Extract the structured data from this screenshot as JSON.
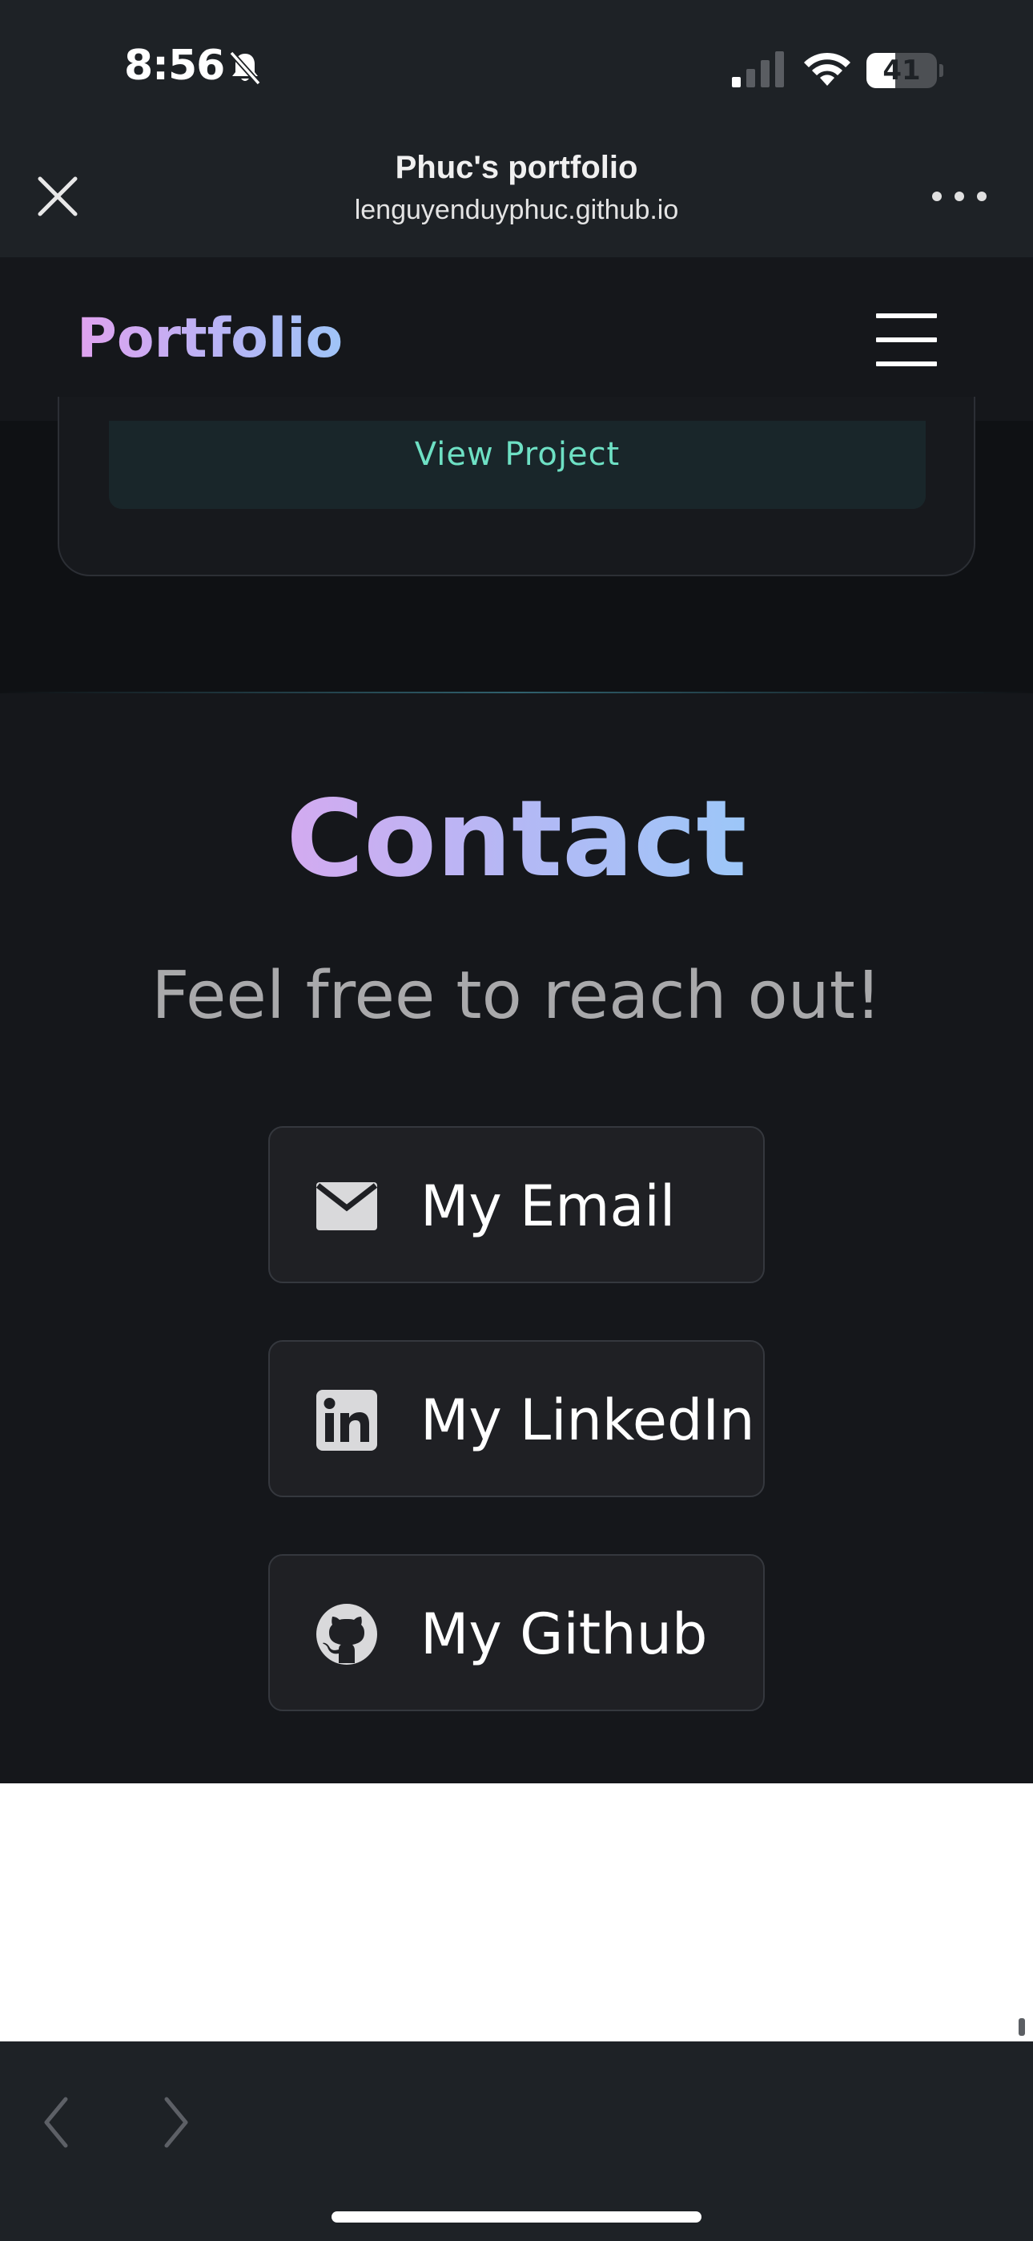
{
  "status_bar": {
    "time": "8:56",
    "battery": "41",
    "battery_level": 0.41
  },
  "browser": {
    "title": "Phuc's portfolio",
    "url": "lenguyenduyphuc.github.io"
  },
  "nav": {
    "logo": "Portfolio"
  },
  "project": {
    "view_label": "View Project"
  },
  "contact": {
    "title": "Contact",
    "subtitle": "Feel free to reach out!",
    "links": [
      {
        "label": "My Email",
        "icon": "envelope-icon"
      },
      {
        "label": "My LinkedIn",
        "icon": "linkedin-icon"
      },
      {
        "label": "My Github",
        "icon": "github-icon"
      }
    ]
  },
  "colors": {
    "accent_teal": "#6ee0c4",
    "gradient_start": "#d3aaf0",
    "gradient_end": "#9cc7f8",
    "page_dark": "#15171b"
  }
}
